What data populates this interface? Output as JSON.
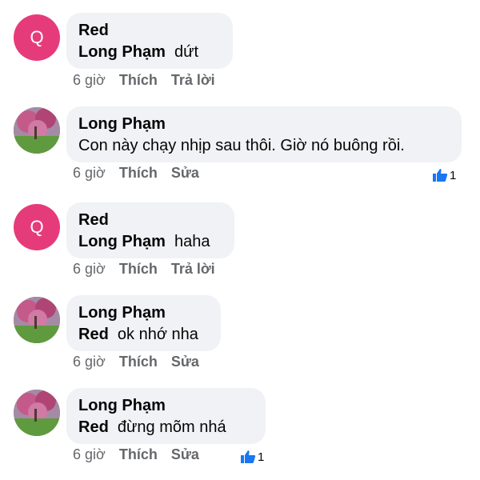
{
  "comments": [
    {
      "author": "Red",
      "mention": "Long Phạm",
      "text": "dứt",
      "avatar": "letter",
      "avatar_letter": "Q",
      "time": "6 giờ",
      "like": "Thích",
      "action": "Trả lời",
      "reactions": null
    },
    {
      "author": "Long Phạm",
      "mention": "",
      "text": "Con này chạy nhịp sau thôi. Giờ nó buông rồi.",
      "avatar": "photo",
      "time": "6 giờ",
      "like": "Thích",
      "action": "Sửa",
      "reactions": "1"
    },
    {
      "author": "Red",
      "mention": "Long Phạm",
      "text": "haha",
      "avatar": "letter",
      "avatar_letter": "Q",
      "time": "6 giờ",
      "like": "Thích",
      "action": "Trả lời",
      "reactions": null
    },
    {
      "author": "Long Phạm",
      "mention": "Red",
      "text": "ok nhớ nha",
      "avatar": "photo",
      "time": "6 giờ",
      "like": "Thích",
      "action": "Sửa",
      "reactions": null
    },
    {
      "author": "Long Phạm",
      "mention": "Red",
      "text": "đừng mõm nhá",
      "avatar": "photo",
      "time": "6 giờ",
      "like": "Thích",
      "action": "Sửa",
      "reactions": "1"
    }
  ],
  "colors": {
    "avatar_letter_bg": "#e63b7a",
    "bubble_bg": "#f0f2f5",
    "like_blue": "#1877f2",
    "meta_gray": "#65676b"
  },
  "icons": {
    "reaction": "thumbs-up-icon"
  }
}
